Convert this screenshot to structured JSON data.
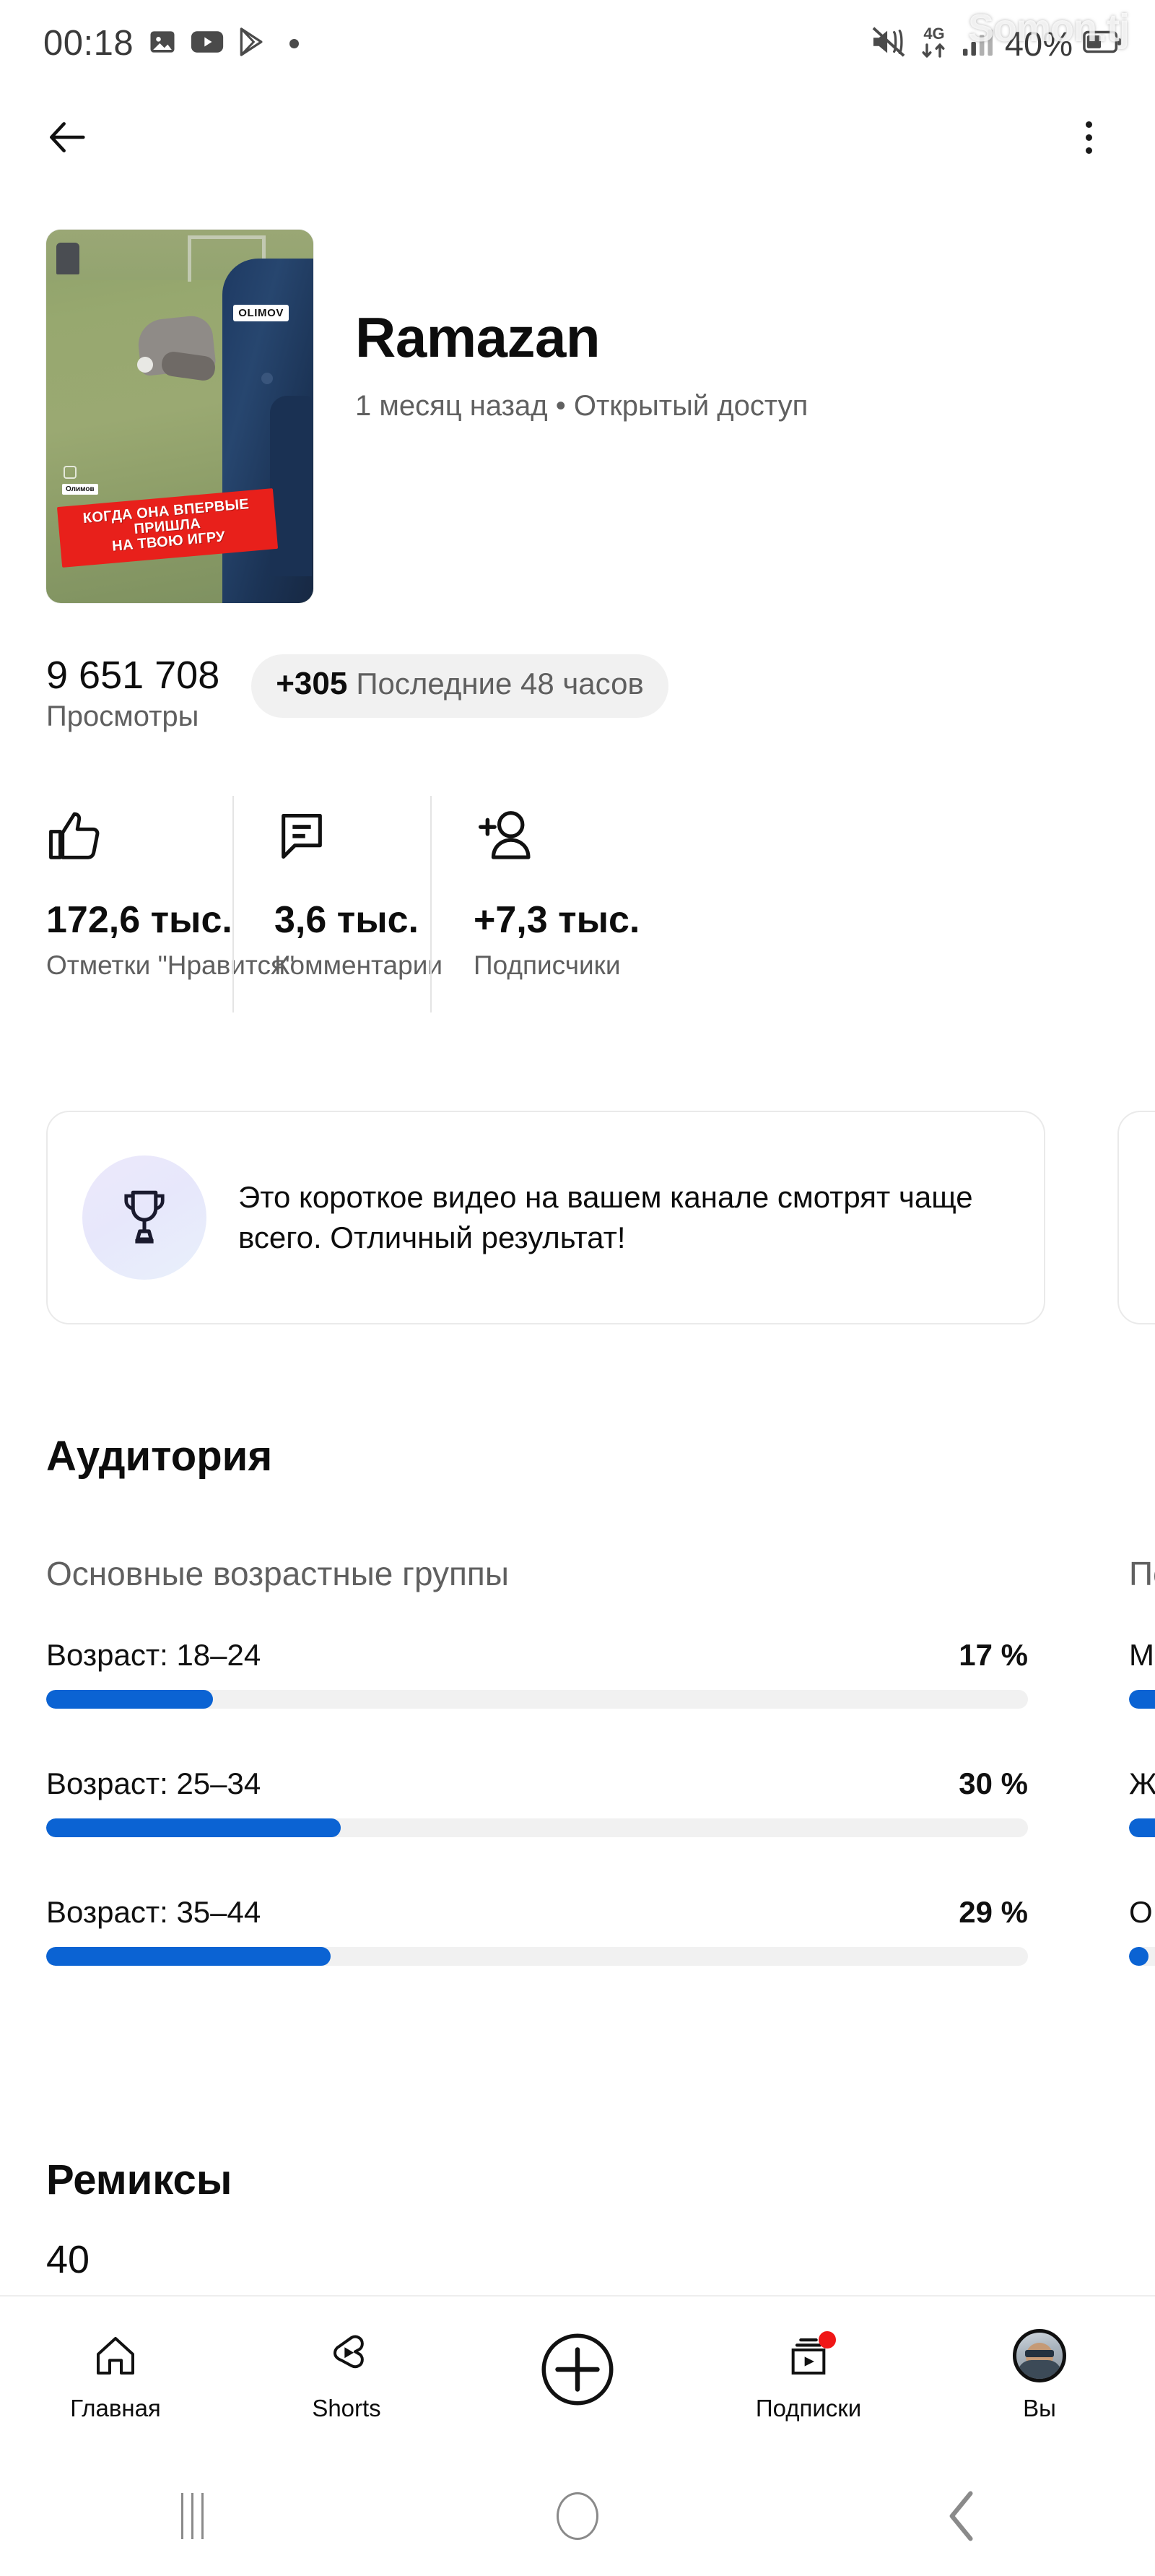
{
  "status_bar": {
    "time": "00:18",
    "icons_left": [
      "gallery-icon",
      "youtube-icon",
      "play-store-icon",
      "dot-separator-icon"
    ],
    "icons_right": [
      "mute-icon",
      "network-4g-icon",
      "signal-bars-icon"
    ],
    "battery_percent": "40%",
    "battery_icon": "battery-icon",
    "watermark": "Somon.tj"
  },
  "top_nav": {
    "back_icon": "back-arrow-icon",
    "menu_icon": "more-vertical-icon"
  },
  "video": {
    "thumbnail": {
      "alt": "video-thumbnail",
      "watermark_large": "OLIMOV",
      "watermark_small": "Олимов",
      "caption_line1": "КОГДА ОНА ВПЕРВЫЕ ПРИШЛА",
      "caption_line2": "НА ТВОЮ ИГРУ",
      "caption_bg": "#e8201b"
    },
    "title": "Ramazan",
    "subtitle": "1 месяц назад • Открытый доступ"
  },
  "views": {
    "count": "9 651 708",
    "label": "Просмотры",
    "badge_value": "+305",
    "badge_label": "Последние 48 часов"
  },
  "metrics": [
    {
      "icon": "thumbs-up-icon",
      "value": "172,6 тыс.",
      "label": "Отметки \"Нравится\""
    },
    {
      "icon": "comment-icon",
      "value": "3,6 тыс.",
      "label": "Комментарии"
    },
    {
      "icon": "add-person-icon",
      "value": "+7,3 тыс.",
      "label": "Подписчики"
    }
  ],
  "insight_card": {
    "icon": "trophy-icon",
    "text": "Это короткое видео на вашем канале смотрят чаще всего. Отличный результат!"
  },
  "audience": {
    "title": "Аудитория",
    "age_subtitle": "Основные возрастные группы",
    "gender_subtitle": "Пол",
    "accent_color": "#0b63d3",
    "track_color": "#f1f1f1"
  },
  "remixes": {
    "title": "Ремиксы",
    "count": "40"
  },
  "bottom_nav": [
    {
      "icon": "home-icon",
      "label": "Главная",
      "badge": false
    },
    {
      "icon": "shorts-icon",
      "label": "Shorts",
      "badge": false
    },
    {
      "icon": "create-plus-icon",
      "label": "",
      "badge": false
    },
    {
      "icon": "subscriptions-icon",
      "label": "Подписки",
      "badge": true
    },
    {
      "icon": "account-avatar-icon",
      "label": "Вы",
      "badge": false
    }
  ],
  "system_nav": {
    "recents": "recents-icon",
    "home": "home-circle-icon",
    "back": "back-chevron-icon"
  },
  "chart_data": [
    {
      "type": "bar",
      "title": "Основные возрастные группы",
      "categories": [
        "Возраст: 18–24",
        "Возраст: 25–34",
        "Возраст: 35–44"
      ],
      "values": [
        17,
        30,
        29
      ],
      "value_labels": [
        "17 %",
        "30 %",
        "29 %"
      ],
      "xlabel": "",
      "ylabel": "",
      "ylim": [
        0,
        100
      ],
      "orientation": "horizontal",
      "grid": false,
      "legend": "none"
    },
    {
      "type": "bar",
      "title": "Пол",
      "categories": [
        "М",
        "Ж",
        "О"
      ],
      "values": [
        70,
        28,
        2
      ],
      "value_labels": [
        "",
        "",
        ""
      ],
      "xlabel": "",
      "ylabel": "",
      "ylim": [
        0,
        100
      ],
      "orientation": "horizontal",
      "grid": false,
      "legend": "none",
      "note": "column clipped at right edge of screen"
    }
  ]
}
